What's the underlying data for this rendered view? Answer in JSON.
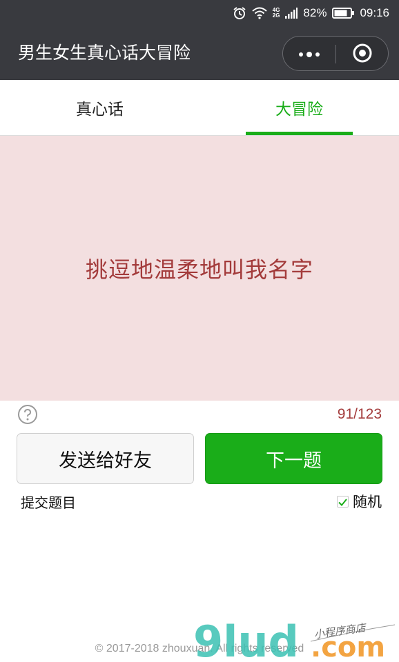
{
  "status_bar": {
    "network": "4G",
    "network2": "2G",
    "battery": "82%",
    "time": "09:16",
    "icons": [
      "alarm-icon",
      "wifi-icon",
      "signal-icon",
      "battery-icon"
    ]
  },
  "header": {
    "title": "男生女生真心话大冒险",
    "icons": [
      "more-dots-icon",
      "close-target-icon"
    ]
  },
  "tabs": [
    {
      "label": "真心话",
      "active": false
    },
    {
      "label": "大冒险",
      "active": true
    }
  ],
  "card": {
    "question": "挑逗地温柔地叫我名字"
  },
  "progress": {
    "counter": "91/123"
  },
  "buttons": {
    "share_label": "发送给好友",
    "next_label": "下一题"
  },
  "options": {
    "submit_label": "提交题目",
    "random_label": "随机",
    "random_checked": true
  },
  "footer": {
    "copyright": "© 2017-2018 zhouxuan. All rights reserved",
    "watermark_main": "9lud",
    "watermark_com": ".com",
    "watermark_sub": "小程序商店"
  },
  "colors": {
    "accent": "#1aad19",
    "question_text": "#a33b3b",
    "card_bg": "#f3dfe0",
    "titlebar_bg": "#393a3f"
  }
}
